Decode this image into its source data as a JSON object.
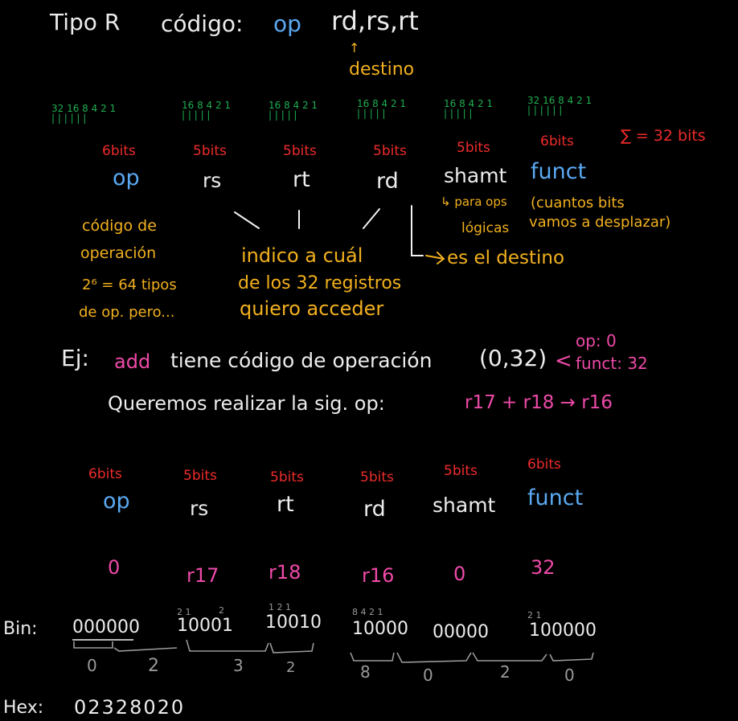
{
  "header": {
    "tipo": "Tipo R",
    "codigo_label": "código:",
    "op": "op",
    "operands": "rd,rs,rt",
    "arrow": "↑",
    "destino": "destino"
  },
  "bit_weights": [
    {
      "labels": "32 16 8 4 2 1",
      "bars": "|  |  | | | |"
    },
    {
      "labels": "16 8 4 2 1",
      "bars": "| | | | |"
    },
    {
      "labels": "16 8 4 2 1",
      "bars": "| | | | |"
    },
    {
      "labels": "16 8 4 2 1",
      "bars": "| | | | |"
    },
    {
      "labels": "16 8 4 2 1",
      "bars": "| | | | |"
    },
    {
      "labels": "32 16 8 4 2 1",
      "bars": "|  |  | | | |"
    }
  ],
  "fields_top": {
    "sizes": [
      "6bits",
      "5bits",
      "5bits",
      "5bits",
      "5bits",
      "6bits"
    ],
    "names": [
      "op",
      "rs",
      "rt",
      "rd",
      "shamt",
      "funct"
    ],
    "total": "∑ = 32 bits"
  },
  "notes": {
    "op_line1": "código de",
    "op_line2": "operación",
    "op_line3": "2⁶ = 64 tipos",
    "op_line4": "de op. pero...",
    "regs_line1": "indico a cuál",
    "regs_line2": "de los 32 registros",
    "regs_line3": "quiero acceder",
    "rd_note": "es el destino",
    "shamt_line1": "↳ para ops",
    "shamt_line2": "lógicas",
    "shamt_paren1": "(cuantos bits",
    "shamt_paren2": "vamos a desplazar)"
  },
  "example": {
    "ej": "Ej:",
    "add": "add",
    "text": "tiene código de operación",
    "pair": "(0,32)",
    "brace": "<",
    "op0": "op: 0",
    "funct32": "funct: 32",
    "queremos": "Queremos realizar la sig. op:",
    "operation": "r17 + r18 → r16"
  },
  "fields_bottom": {
    "sizes": [
      "6bits",
      "5bits",
      "5bits",
      "5bits",
      "5bits",
      "6bits"
    ],
    "names": [
      "op",
      "rs",
      "rt",
      "rd",
      "shamt",
      "funct"
    ],
    "values": [
      "0",
      "r17",
      "r18",
      "r16",
      "0",
      "32"
    ]
  },
  "binary": {
    "label": "Bin:",
    "groups": [
      "000000",
      "10001",
      "10010",
      "10000",
      "00000",
      "100000"
    ],
    "weights_rs": "2 1",
    "weights_rt_a": "2",
    "weights_rt_b": "1   2 1",
    "weights_rd": "8 4 2 1",
    "weights_funct": "2 1",
    "nibbles": [
      "0",
      "2",
      "3",
      "2",
      "8",
      "0",
      "2",
      "0"
    ]
  },
  "hex": {
    "label": "Hex:",
    "value": "02328020"
  },
  "colors": {
    "background": "#000000",
    "white": "#ececec",
    "blue": "#5aa9f2",
    "yellow": "#f2b01e",
    "red": "#ee2b2b",
    "pink": "#ee4aa8",
    "green": "#1fae52",
    "gray": "#9a9a9a"
  }
}
